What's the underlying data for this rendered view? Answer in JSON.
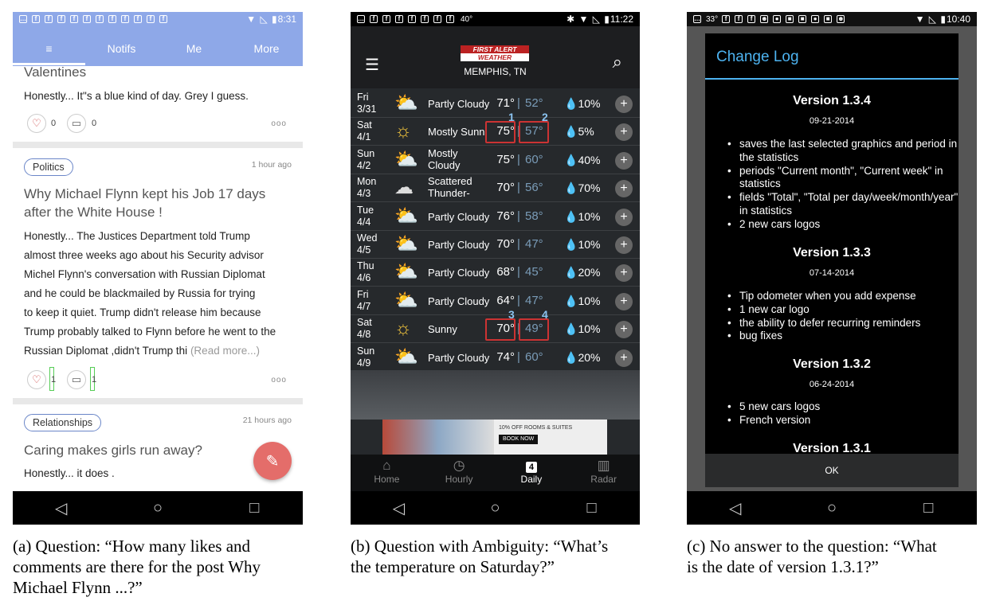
{
  "panel_a": {
    "status_time": "8:31",
    "tabs": [
      "Notifs",
      "Me",
      "More"
    ],
    "post1": {
      "title": "Valentines",
      "body": "Honestly... It\"s a blue kind of day. Grey I guess.",
      "likes": "0",
      "comments": "0"
    },
    "post2": {
      "tag": "Politics",
      "time": "1 hour ago",
      "title_l1": "Why Michael Flynn kept his Job 17 days",
      "title_l2": "after the White House !",
      "body": [
        "Honestly... The Justices Department told Trump",
        "almost three weeks ago about his Security advisor",
        "Michel Flynn's conversation with Russian Diplomat",
        "and he could be blackmailed by Russia for trying",
        "to keep it quiet. Trump didn't release him because",
        "Trump probably talked to Flynn  before he went to the",
        "Russian Diplomat ,didn't Trump thi"
      ],
      "read_more": "(Read more...)",
      "likes": "1",
      "comments": "1"
    },
    "post3": {
      "tag": "Relationships",
      "time": "21 hours ago",
      "title": "Caring makes girls run away?",
      "body": "Honestly... it does ."
    },
    "caption": [
      "(a) Question: “How many likes and",
      "comments are there for the post Why",
      "Michael Flynn ...?”"
    ]
  },
  "panel_b": {
    "status_time": "11:22",
    "status_temp": "40°",
    "logo_l1": "FIRST ALERT",
    "logo_l2": "WEATHER",
    "city": "MEMPHIS, TN",
    "rows": [
      {
        "d1": "Fri",
        "d2": "3/31",
        "cond": "Partly Cloudy",
        "hi": "71°",
        "lo": "52°",
        "pct": "10%"
      },
      {
        "d1": "Sat",
        "d2": "4/1",
        "cond": "Mostly Sunn",
        "hi": "75°",
        "lo": "57°",
        "pct": "5%"
      },
      {
        "d1": "Sun",
        "d2": "4/2",
        "cond": "Mostly",
        "cond2": "Cloudy",
        "hi": "75°",
        "lo": "60°",
        "pct": "40%"
      },
      {
        "d1": "Mon",
        "d2": "4/3",
        "cond": "Scattered",
        "cond2": "Thunder-",
        "hi": "70°",
        "lo": "56°",
        "pct": "70%"
      },
      {
        "d1": "Tue",
        "d2": "4/4",
        "cond": "Partly Cloudy",
        "hi": "76°",
        "lo": "58°",
        "pct": "10%"
      },
      {
        "d1": "Wed",
        "d2": "4/5",
        "cond": "Partly Cloudy",
        "hi": "70°",
        "lo": "47°",
        "pct": "10%"
      },
      {
        "d1": "Thu",
        "d2": "4/6",
        "cond": "Partly Cloudy",
        "hi": "68°",
        "lo": "45°",
        "pct": "20%"
      },
      {
        "d1": "Fri",
        "d2": "4/7",
        "cond": "Partly Cloudy",
        "hi": "64°",
        "lo": "47°",
        "pct": "10%"
      },
      {
        "d1": "Sat",
        "d2": "4/8",
        "cond": "Sunny",
        "hi": "70°",
        "lo": "49°",
        "pct": "10%"
      },
      {
        "d1": "Sun",
        "d2": "4/9",
        "cond": "Partly Cloudy",
        "hi": "74°",
        "lo": "60°",
        "pct": "20%"
      }
    ],
    "markers": [
      "1",
      "2",
      "3",
      "4"
    ],
    "ad_text": "10% OFF ROOMS & SUITES",
    "ad_btn": "BOOK NOW",
    "bottom_tabs": [
      "Home",
      "Hourly",
      "Daily",
      "Radar"
    ],
    "daily_num": "4",
    "caption": [
      "(b) Question with Ambiguity: “What’s",
      "the temperature on Saturday?”"
    ]
  },
  "panel_c": {
    "status_time": "10:40",
    "status_temp": "33°",
    "title": "Change Log",
    "versions": [
      {
        "v": "Version 1.3.4",
        "date": "09-21-2014",
        "items": [
          "saves the last selected graphics and period in the statistics",
          "periods \"Current month\", \"Current week\" in statistics",
          "fields \"Total\", \"Total per day/week/month/year\" in statistics",
          "2 new cars logos"
        ]
      },
      {
        "v": "Version 1.3.3",
        "date": "07-14-2014",
        "items": [
          "Tip odometer when you add expense",
          "1 new car logo",
          "the ability to defer recurring reminders",
          "bug fixes"
        ]
      },
      {
        "v": "Version 1.3.2",
        "date": "06-24-2014",
        "items": [
          "5 new cars logos",
          "French version"
        ]
      }
    ],
    "cut_version": "Version 1.3.1",
    "ok": "OK",
    "caption": [
      "(c) No answer to the question: “What",
      "is the date of version 1.3.1?”"
    ]
  }
}
